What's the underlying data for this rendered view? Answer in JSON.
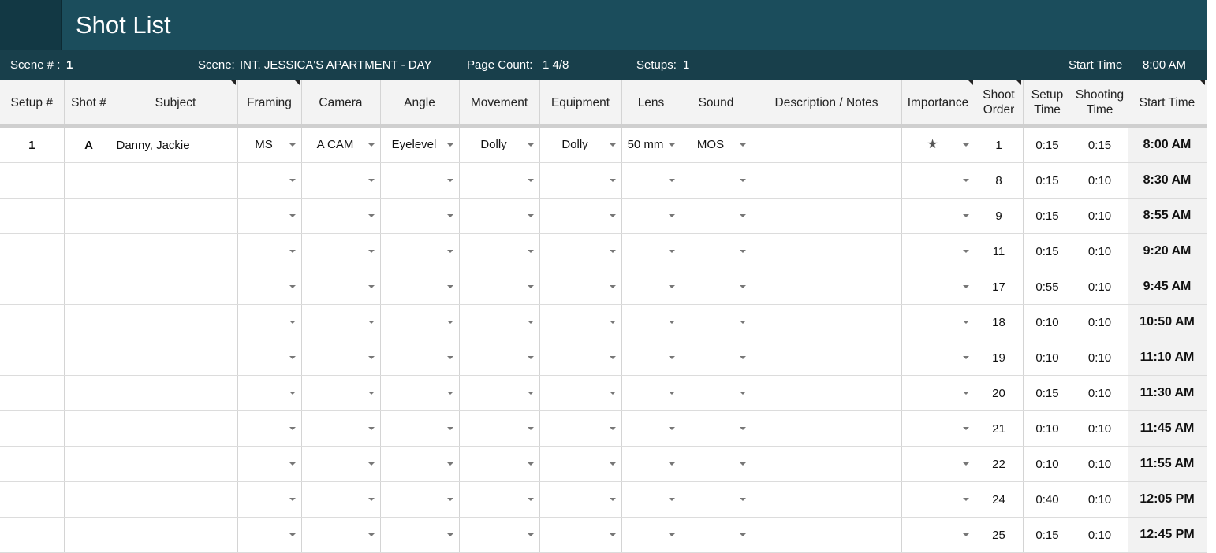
{
  "title": "Shot List",
  "colors": {
    "title_bg": "#1b4d5c",
    "info_bg": "#183f4b",
    "header_bg": "#f3f3f3"
  },
  "info": {
    "scene_num_label": "Scene # :",
    "scene_num": "1",
    "scene_label": "Scene:",
    "scene": "INT. JESSICA'S APARTMENT - DAY",
    "page_count_label": "Page Count:",
    "page_count": "1 4/8",
    "setups_label": "Setups:",
    "setups": "1",
    "start_time_label": "Start Time",
    "start_time": "8:00 AM"
  },
  "columns": {
    "setup": "Setup #",
    "shot": "Shot #",
    "subject": "Subject",
    "framing": "Framing",
    "camera": "Camera",
    "angle": "Angle",
    "movement": "Movement",
    "equipment": "Equipment",
    "lens": "Lens",
    "sound": "Sound",
    "description": "Description / Notes",
    "importance": "Importance",
    "shoot_order_1": "Shoot",
    "shoot_order_2": "Order",
    "setup_time_1": "Setup",
    "setup_time_2": "Time",
    "shooting_time_1": "Shooting",
    "shooting_time_2": "Time",
    "start_time": "Start Time"
  },
  "rows": [
    {
      "setup": "1",
      "shot": "A",
      "subject": "Danny, Jackie",
      "framing": "MS",
      "camera": "A CAM",
      "angle": "Eyelevel",
      "movement": "Dolly",
      "equipment": "Dolly",
      "lens": "50 mm",
      "sound": "MOS",
      "description": "",
      "importance": "★",
      "order": "1",
      "setup_time": "0:15",
      "shooting_time": "0:15",
      "start": "8:00 AM"
    },
    {
      "setup": "",
      "shot": "",
      "subject": "",
      "framing": "",
      "camera": "",
      "angle": "",
      "movement": "",
      "equipment": "",
      "lens": "",
      "sound": "",
      "description": "",
      "importance": "",
      "order": "8",
      "setup_time": "0:15",
      "shooting_time": "0:10",
      "start": "8:30 AM"
    },
    {
      "setup": "",
      "shot": "",
      "subject": "",
      "framing": "",
      "camera": "",
      "angle": "",
      "movement": "",
      "equipment": "",
      "lens": "",
      "sound": "",
      "description": "",
      "importance": "",
      "order": "9",
      "setup_time": "0:15",
      "shooting_time": "0:10",
      "start": "8:55 AM"
    },
    {
      "setup": "",
      "shot": "",
      "subject": "",
      "framing": "",
      "camera": "",
      "angle": "",
      "movement": "",
      "equipment": "",
      "lens": "",
      "sound": "",
      "description": "",
      "importance": "",
      "order": "11",
      "setup_time": "0:15",
      "shooting_time": "0:10",
      "start": "9:20 AM"
    },
    {
      "setup": "",
      "shot": "",
      "subject": "",
      "framing": "",
      "camera": "",
      "angle": "",
      "movement": "",
      "equipment": "",
      "lens": "",
      "sound": "",
      "description": "",
      "importance": "",
      "order": "17",
      "setup_time": "0:55",
      "shooting_time": "0:10",
      "start": "9:45 AM"
    },
    {
      "setup": "",
      "shot": "",
      "subject": "",
      "framing": "",
      "camera": "",
      "angle": "",
      "movement": "",
      "equipment": "",
      "lens": "",
      "sound": "",
      "description": "",
      "importance": "",
      "order": "18",
      "setup_time": "0:10",
      "shooting_time": "0:10",
      "start": "10:50 AM"
    },
    {
      "setup": "",
      "shot": "",
      "subject": "",
      "framing": "",
      "camera": "",
      "angle": "",
      "movement": "",
      "equipment": "",
      "lens": "",
      "sound": "",
      "description": "",
      "importance": "",
      "order": "19",
      "setup_time": "0:10",
      "shooting_time": "0:10",
      "start": "11:10 AM"
    },
    {
      "setup": "",
      "shot": "",
      "subject": "",
      "framing": "",
      "camera": "",
      "angle": "",
      "movement": "",
      "equipment": "",
      "lens": "",
      "sound": "",
      "description": "",
      "importance": "",
      "order": "20",
      "setup_time": "0:15",
      "shooting_time": "0:10",
      "start": "11:30 AM"
    },
    {
      "setup": "",
      "shot": "",
      "subject": "",
      "framing": "",
      "camera": "",
      "angle": "",
      "movement": "",
      "equipment": "",
      "lens": "",
      "sound": "",
      "description": "",
      "importance": "",
      "order": "21",
      "setup_time": "0:10",
      "shooting_time": "0:10",
      "start": "11:45 AM"
    },
    {
      "setup": "",
      "shot": "",
      "subject": "",
      "framing": "",
      "camera": "",
      "angle": "",
      "movement": "",
      "equipment": "",
      "lens": "",
      "sound": "",
      "description": "",
      "importance": "",
      "order": "22",
      "setup_time": "0:10",
      "shooting_time": "0:10",
      "start": "11:55 AM"
    },
    {
      "setup": "",
      "shot": "",
      "subject": "",
      "framing": "",
      "camera": "",
      "angle": "",
      "movement": "",
      "equipment": "",
      "lens": "",
      "sound": "",
      "description": "",
      "importance": "",
      "order": "24",
      "setup_time": "0:40",
      "shooting_time": "0:10",
      "start": "12:05 PM"
    },
    {
      "setup": "",
      "shot": "",
      "subject": "",
      "framing": "",
      "camera": "",
      "angle": "",
      "movement": "",
      "equipment": "",
      "lens": "",
      "sound": "",
      "description": "",
      "importance": "",
      "order": "25",
      "setup_time": "0:15",
      "shooting_time": "0:10",
      "start": "12:45 PM"
    }
  ]
}
